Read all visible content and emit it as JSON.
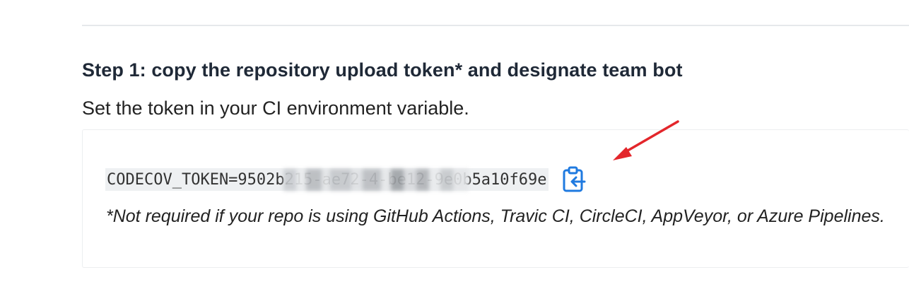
{
  "step": {
    "title": "Step 1: copy the repository upload token* and designate team bot",
    "subtitle": "Set the token in your CI environment variable."
  },
  "token": {
    "prefix": "CODECOV_TOKEN=9502b215-ae72-4",
    "suffix": "be12-9e0b5a10f69e",
    "copy_icon": "clipboard-copy-icon"
  },
  "footnote": {
    "text": "*Not required if your repo is using GitHub Actions, Travic CI, CircleCI, AppVeyor, or Azure Pipelines."
  },
  "colors": {
    "copy_icon": "#1f7ae0",
    "annotation_arrow": "#e3262b",
    "code_background": "#eef0f2"
  }
}
